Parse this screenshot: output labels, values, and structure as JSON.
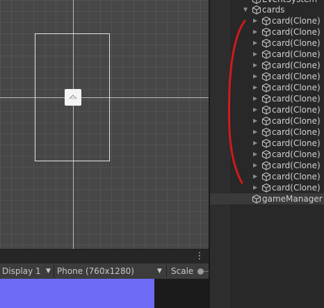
{
  "game_toolbar": {
    "display_select": "Display 1",
    "resolution_select": "Phone (760x1280)",
    "scale_label": "Scale"
  },
  "hierarchy": {
    "top_item": "EventSystem",
    "cards_label": "cards",
    "children": [
      "card(Clone)",
      "card(Clone)",
      "card(Clone)",
      "card(Clone)",
      "card(Clone)",
      "card(Clone)",
      "card(Clone)",
      "card(Clone)",
      "card(Clone)",
      "card(Clone)",
      "card(Clone)",
      "card(Clone)",
      "card(Clone)",
      "card(Clone)",
      "card(Clone)",
      "card(Clone)"
    ],
    "game_manager": "gameManager"
  },
  "colors": {
    "game_background": "#6e6cf6",
    "annotation": "#d11a1a"
  },
  "icons": {
    "gameobject": "cube-icon",
    "expand": "triangle-right-icon",
    "expanded": "triangle-down-icon",
    "menu": "kebab-menu-icon",
    "dropdown": "caret-down-icon"
  }
}
